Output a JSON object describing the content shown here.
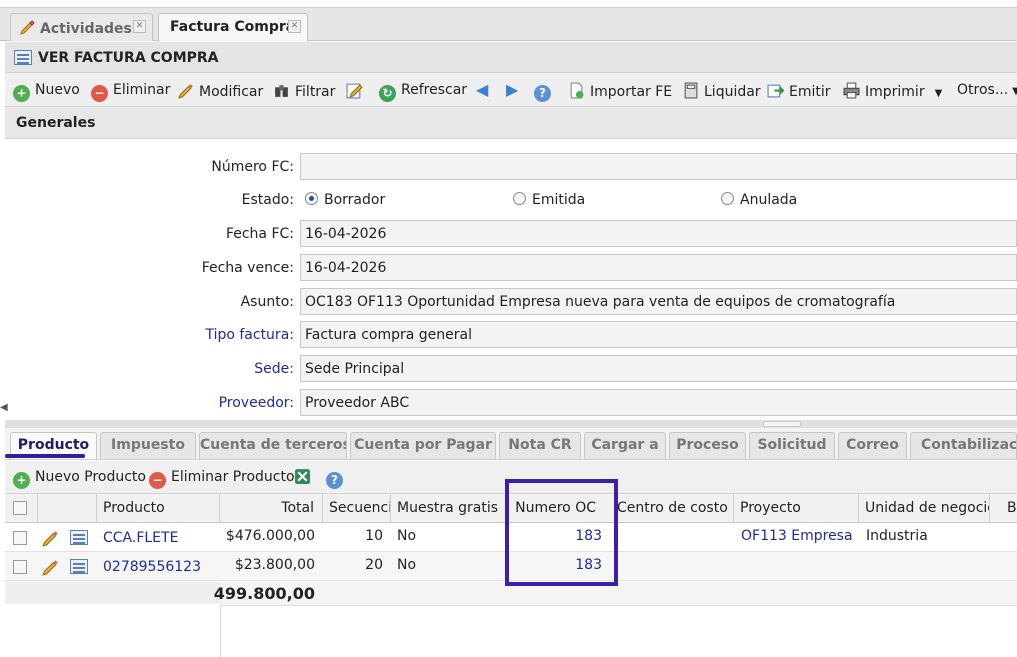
{
  "tabs": [
    {
      "label": "Actividades",
      "close": "✕"
    },
    {
      "label": "Factura Compra",
      "close": "✕"
    }
  ],
  "window_title": "VER FACTURA COMPRA",
  "toolbar": {
    "nuevo": "Nuevo",
    "eliminar": "Eliminar",
    "modificar": "Modificar",
    "filtrar": "Filtrar",
    "refrescar": "Refrescar",
    "importar": "Importar FE",
    "liquidar": "Liquidar",
    "emitir": "Emitir",
    "imprimir": "Imprimir",
    "otros": "Otros..."
  },
  "section_title": "Generales",
  "form": {
    "numero_label": "Número FC:",
    "numero_value": "",
    "estado_label": "Estado:",
    "estado_options": [
      "Borrador",
      "Emitida",
      "Anulada"
    ],
    "estado_selected": "Borrador",
    "fecha_label": "Fecha FC:",
    "fecha_value": "16-04-2026",
    "vence_label": "Fecha vence:",
    "vence_value": "16-04-2026",
    "asunto_label": "Asunto:",
    "asunto_value": "OC183 OF113 Oportunidad Empresa nueva para venta de equipos de cromatografía",
    "tipo_label": "Tipo factura:",
    "tipo_value": "Factura compra general",
    "sede_label": "Sede:",
    "sede_value": "Sede Principal",
    "proveedor_label": "Proveedor:",
    "proveedor_value": "Proveedor ABC"
  },
  "detail_tabs": [
    "Producto",
    "Impuesto",
    "Cuenta de terceros",
    "Cuenta por Pagar",
    "Nota CR",
    "Cargar a",
    "Proceso",
    "Solicitud",
    "Correo",
    "Contabilizació"
  ],
  "grid_toolbar": {
    "nuevo_producto": "Nuevo Producto",
    "eliminar_producto": "Eliminar Producto"
  },
  "grid": {
    "headers": [
      "Producto",
      "Total",
      "Secuencia",
      "Muestra gratis",
      "Numero OC",
      "Centro de costo",
      "Proyecto",
      "Unidad de negocio..",
      "Ba"
    ],
    "rows": [
      {
        "producto": "CCA.FLETE",
        "total": "$476.000,00",
        "secuencia": "10",
        "muestra": "No",
        "numero_oc": "183",
        "centro": "",
        "proyecto": "OF113 Empresa...",
        "unidad": "Industria"
      },
      {
        "producto": "02789556123",
        "total": "$23.800,00",
        "secuencia": "20",
        "muestra": "No",
        "numero_oc": "183",
        "centro": "",
        "proyecto": "",
        "unidad": ""
      }
    ],
    "sum_total": "499.800,00"
  },
  "colors": {
    "accent": "#2b1fa6",
    "link": "#1e2aa0"
  }
}
